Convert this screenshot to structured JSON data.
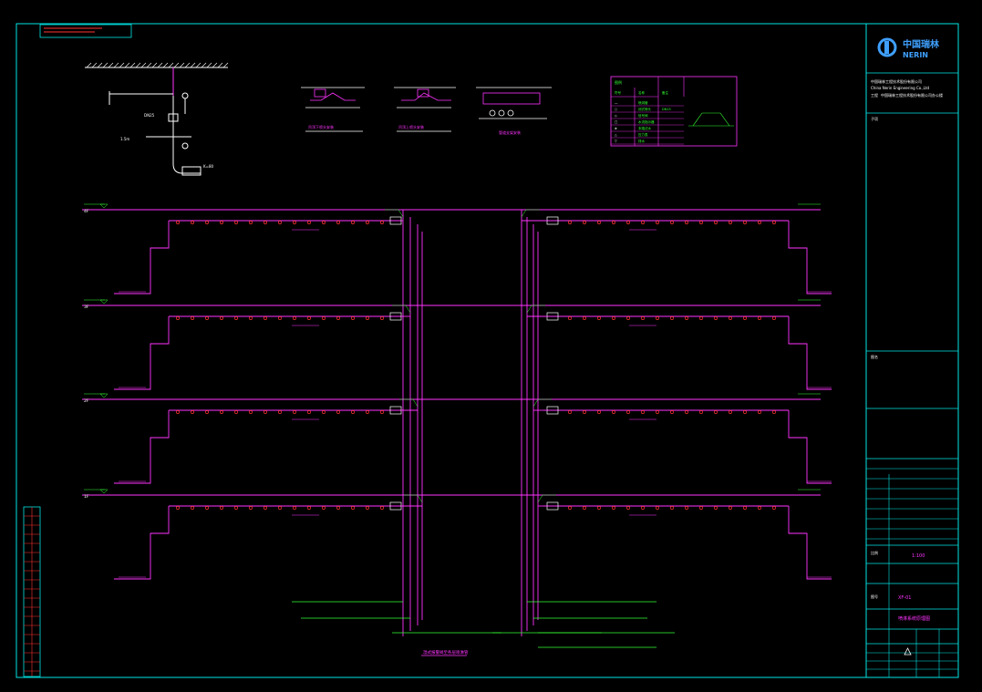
{
  "colors": {
    "background": "#000000",
    "frame": "#00e5e5",
    "pipe": "#ff33ff",
    "sprinkler": "#ff3333",
    "annotation": "#33ff33",
    "label": "#ffffff",
    "yellow": "#ffff33"
  },
  "title_block": {
    "logo_text": "中国瑞林",
    "logo_sub": "NERIN",
    "company_line1": "中国瑞林工程技术股份有限公司",
    "company_line2": "China Nerin Engineering Co.,Ltd",
    "project_label": "工程",
    "project_name": "中国瑞林工程技术股份有限公司办公楼",
    "sub_label": "子项",
    "drawing_label": "图名",
    "drawing_title": "喷淋系统原理图",
    "scale_label": "比例",
    "scale_value": "1:100",
    "sheet_label": "图号",
    "sheet_value": "XF-01"
  },
  "floors": [
    {
      "label": "4F"
    },
    {
      "label": "3F"
    },
    {
      "label": "2F"
    },
    {
      "label": "1F"
    }
  ],
  "main_label": "湿式报警阀至各层喷淋管",
  "detail_titles": {
    "riser_detail": "末端试水装置示意",
    "sprinkler_a": "吊顶下喷头安装",
    "sprinkler_b": "吊顶上喷头安装",
    "sprinkler_c": "管道支架安装"
  },
  "legend": {
    "title": "图例",
    "headers": [
      "符号",
      "名称",
      "备注"
    ],
    "rows": [
      [
        "—",
        "喷淋管",
        ""
      ],
      [
        "○",
        "闭式喷头",
        "DN15"
      ],
      [
        "◇",
        "信号阀",
        ""
      ],
      [
        "□",
        "水流指示器",
        ""
      ],
      [
        "⊗",
        "末端试水",
        ""
      ],
      [
        "△",
        "压力表",
        ""
      ],
      [
        "▽",
        "排水",
        ""
      ]
    ]
  }
}
